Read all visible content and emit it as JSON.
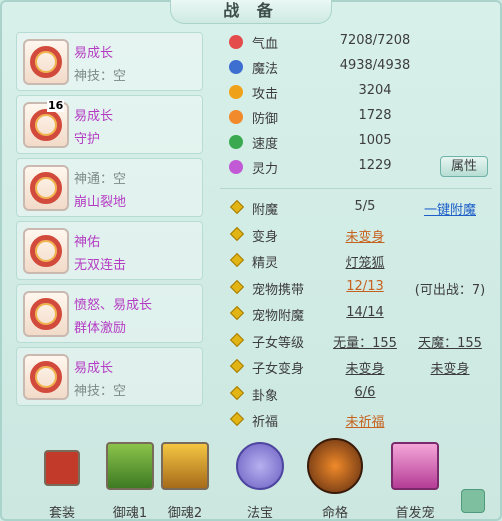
{
  "title": "战 备",
  "equipment": [
    {
      "line1": "易成长",
      "line2": "神技：空",
      "badge": ""
    },
    {
      "line1": "易成长",
      "line2": "守护",
      "badge": "16"
    },
    {
      "line1": "神通：空",
      "line2": "崩山裂地",
      "badge": ""
    },
    {
      "line1": "神佑",
      "line2": "无双连击",
      "badge": ""
    },
    {
      "line1": "愤怒、易成长",
      "line2": "群体激励",
      "badge": ""
    },
    {
      "line1": "易成长",
      "line2": "神技：空",
      "badge": ""
    }
  ],
  "stats": [
    {
      "label": "气血",
      "value": "7208/7208",
      "icon": "hp-icon",
      "color": "#e44b4b"
    },
    {
      "label": "魔法",
      "value": "4938/4938",
      "icon": "mp-icon",
      "color": "#3c6fd0"
    },
    {
      "label": "攻击",
      "value": "3204",
      "icon": "attack-icon",
      "color": "#f0a11a"
    },
    {
      "label": "防御",
      "value": "1728",
      "icon": "defense-icon",
      "color": "#f08a2a"
    },
    {
      "label": "速度",
      "value": "1005",
      "icon": "speed-icon",
      "color": "#3aa94f"
    },
    {
      "label": "灵力",
      "value": "1229",
      "icon": "spirit-icon",
      "color": "#c25ad6"
    }
  ],
  "attr_button": "属性",
  "rows": [
    {
      "label": "附魔",
      "v1": "5/5",
      "v2": "一键附魔"
    },
    {
      "label": "变身",
      "v1": "未变身",
      "v2": ""
    },
    {
      "label": "精灵",
      "v1": "灯笼狐",
      "v2": ""
    },
    {
      "label": "宠物携带",
      "v1": "12/13",
      "v2": "(可出战：7)"
    },
    {
      "label": "宠物附魔",
      "v1": "14/14",
      "v2": ""
    },
    {
      "label": "子女等级",
      "v1": "无量：155",
      "v2": "天魔：155"
    },
    {
      "label": "子女变身",
      "v1": "未变身",
      "v2": "未变身"
    },
    {
      "label": "卦象",
      "v1": "6/6",
      "v2": ""
    },
    {
      "label": "祈福",
      "v1": "未祈福",
      "v2": ""
    }
  ],
  "bottom": [
    {
      "label": "套装",
      "icon": "suit-icon",
      "color": "#c23a2a"
    },
    {
      "label": "御魂1",
      "icon": "soul1-icon",
      "color": "#5a9a3a"
    },
    {
      "label": "御魂2",
      "icon": "soul2-icon",
      "color": "#c0922a"
    },
    {
      "label": "法宝",
      "icon": "treasure-icon",
      "color": "#7a6fc6"
    },
    {
      "label": "命格",
      "icon": "fate-icon",
      "color": "#b65a1f"
    },
    {
      "label": "首发宠",
      "icon": "pet-icon",
      "color": "#d35fb0"
    }
  ]
}
